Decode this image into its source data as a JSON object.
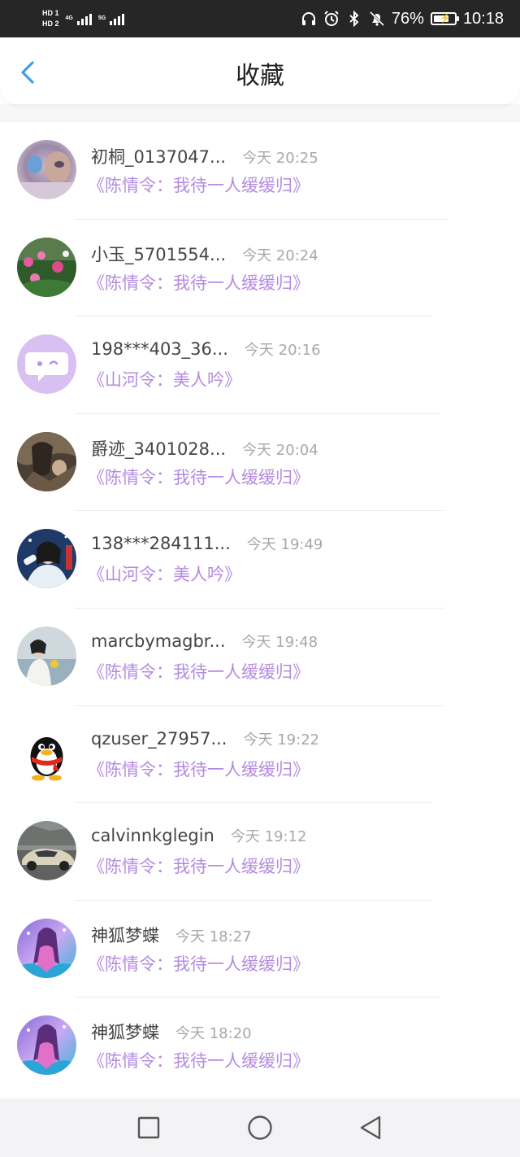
{
  "status_bar": {
    "sim1": "HD 1",
    "sim2": "HD 2",
    "net1": "4G",
    "net2": "5G",
    "battery_percent": "76%",
    "battery_level": 0.76,
    "time": "10:18",
    "icons": [
      "headphones-icon",
      "alarm-icon",
      "bluetooth-icon",
      "mute-bell-icon",
      "battery-charging-icon"
    ]
  },
  "header": {
    "title": "收藏",
    "back_icon": "chevron-left-icon",
    "accent_color": "#3ea0e8"
  },
  "colors": {
    "work_link": "#b48be0",
    "time": "#a8a8a8",
    "username": "#444444"
  },
  "favorites": [
    {
      "user": "初桐_0137047...",
      "time": "今天 20:25",
      "work": "《陈情令：我待一人缓缓归》",
      "avatar": "avatar-blurry-portrait"
    },
    {
      "user": "小玉_5701554...",
      "time": "今天 20:24",
      "work": "《陈情令：我待一人缓缓归》",
      "avatar": "avatar-flowers"
    },
    {
      "user": "198***403_36...",
      "time": "今天 20:16",
      "work": "《山河令：美人吟》",
      "avatar": "avatar-default-chat"
    },
    {
      "user": "爵迹_3401028...",
      "time": "今天 20:04",
      "work": "《陈情令：我待一人缓缓归》",
      "avatar": "avatar-illustration"
    },
    {
      "user": "138***284111...",
      "time": "今天 19:49",
      "work": "《山河令：美人吟》",
      "avatar": "avatar-girl"
    },
    {
      "user": "marcbymagbr...",
      "time": "今天 19:48",
      "work": "《陈情令：我待一人缓缓归》",
      "avatar": "avatar-woman-sea"
    },
    {
      "user": "qzuser_27957...",
      "time": "今天 19:22",
      "work": "《陈情令：我待一人缓缓归》",
      "avatar": "avatar-qq-penguin"
    },
    {
      "user": "calvinnkglegin",
      "time": "今天 19:12",
      "work": "《陈情令：我待一人缓缓归》",
      "avatar": "avatar-car"
    },
    {
      "user": "神狐梦蝶",
      "time": "今天 18:27",
      "work": "《陈情令：我待一人缓缓归》",
      "avatar": "avatar-fox-fantasy"
    },
    {
      "user": "神狐梦蝶",
      "time": "今天 18:20",
      "work": "《陈情令：我待一人缓缓归》",
      "avatar": "avatar-fox-fantasy"
    }
  ],
  "nav_bar": {
    "icons": [
      "recent-apps-square-icon",
      "home-circle-icon",
      "back-triangle-icon"
    ]
  }
}
